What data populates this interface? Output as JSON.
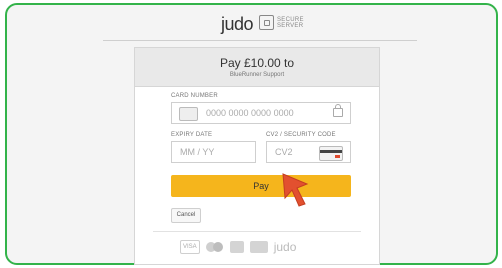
{
  "header": {
    "logo_text": "judo",
    "secure_line1": "SECURE",
    "secure_line2": "SERVER"
  },
  "payment": {
    "title": "Pay £10.00 to",
    "merchant": "BlueRunner Support"
  },
  "card_number": {
    "label": "CARD NUMBER",
    "placeholder": "0000 0000 0000 0000"
  },
  "expiry": {
    "label": "EXPIRY DATE",
    "placeholder": "MM / YY"
  },
  "cv2": {
    "label": "CV2 / SECURITY CODE",
    "placeholder": "CV2"
  },
  "actions": {
    "pay_label": "Pay",
    "cancel_label": "Cancel"
  },
  "footer_logos": {
    "visa": "VISA",
    "judo": "judo"
  },
  "colors": {
    "frame_border": "#33b34a",
    "pay_button": "#f5b51c",
    "cursor": "#e2502f"
  }
}
